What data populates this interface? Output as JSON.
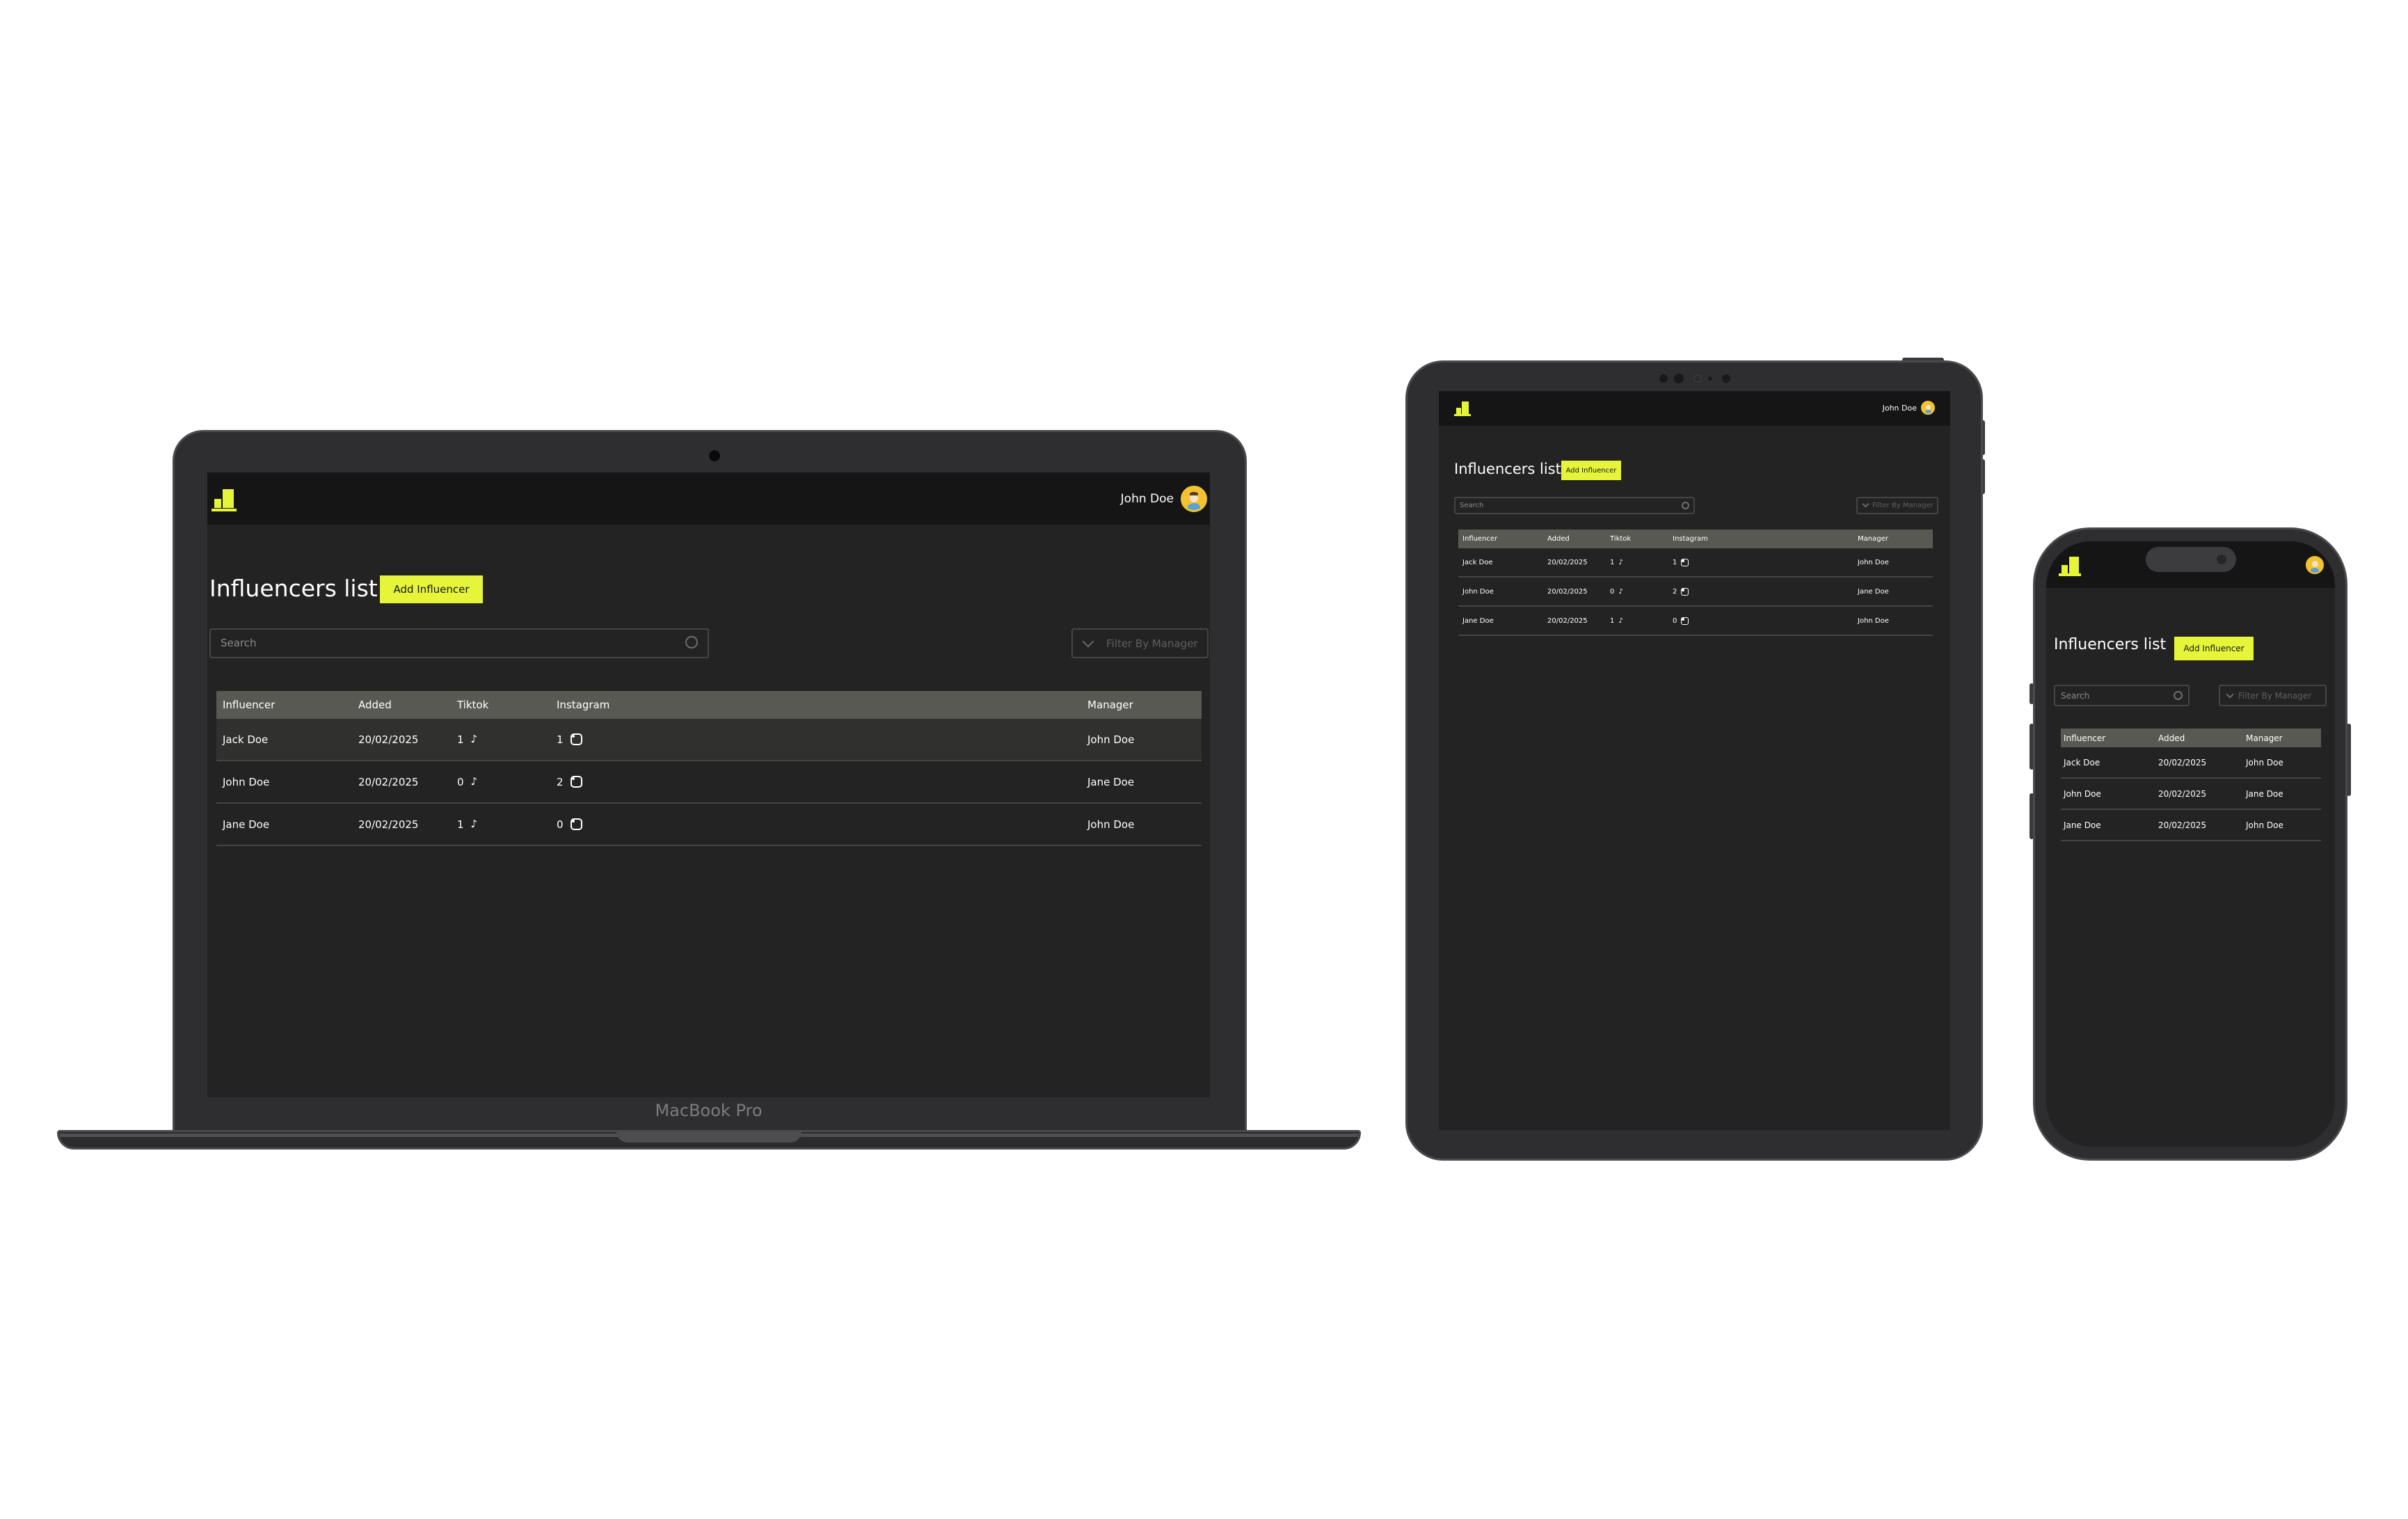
{
  "laptop": {
    "model_label": "MacBook Pro"
  },
  "app": {
    "user_name": "John Doe",
    "page_title": "Influencers list",
    "add_button": "Add Influencer",
    "search_placeholder": "Search",
    "filter_label": "Filter By Manager",
    "columns": {
      "influencer": "Influencer",
      "added": "Added",
      "tiktok": "Tiktok",
      "instagram": "Instagram",
      "manager": "Manager"
    },
    "rows": [
      {
        "influencer": "Jack Doe",
        "added": "20/02/2025",
        "tiktok": "1",
        "instagram": "1",
        "manager": "John Doe"
      },
      {
        "influencer": "John Doe",
        "added": "20/02/2025",
        "tiktok": "0",
        "instagram": "2",
        "manager": "Jane Doe"
      },
      {
        "influencer": "Jane Doe",
        "added": "20/02/2025",
        "tiktok": "1",
        "instagram": "0",
        "manager": "John Doe"
      }
    ]
  },
  "colors": {
    "accent": "#e6f53a",
    "background": "#232323",
    "topbar": "#151515",
    "table_header": "#595954"
  }
}
